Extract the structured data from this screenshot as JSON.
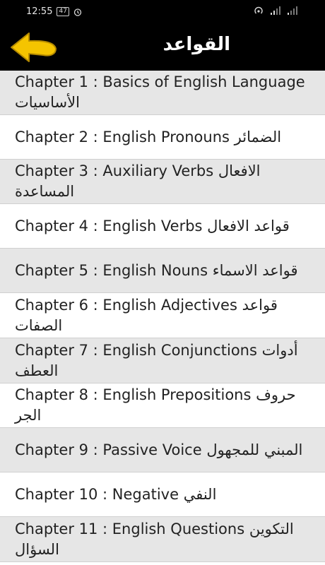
{
  "status_bar": {
    "time": "12:55",
    "battery": "47"
  },
  "toolbar": {
    "title": "القواعد",
    "back_icon": "arrow-left-icon"
  },
  "chapters": [
    {
      "label": "Chapter 1 : Basics of English Language الأساسيات"
    },
    {
      "label": "Chapter 2 : English Pronouns الضمائر"
    },
    {
      "label": "Chapter 3 : Auxiliary Verbs الافعال المساعدة"
    },
    {
      "label": "Chapter 4 : English Verbs قواعد الافعال"
    },
    {
      "label": "Chapter 5 : English Nouns قواعد الاسماء"
    },
    {
      "label": "Chapter 6 : English Adjectives قواعد الصفات"
    },
    {
      "label": "Chapter 7 : English Conjunctions أدوات العطف"
    },
    {
      "label": "Chapter 8 : English Prepositions حروف الجر"
    },
    {
      "label": "Chapter 9 : Passive Voice المبني للمجهول"
    },
    {
      "label": "Chapter 10 : Negative النفي"
    },
    {
      "label": "Chapter 11 : English Questions التكوين السؤال"
    }
  ]
}
